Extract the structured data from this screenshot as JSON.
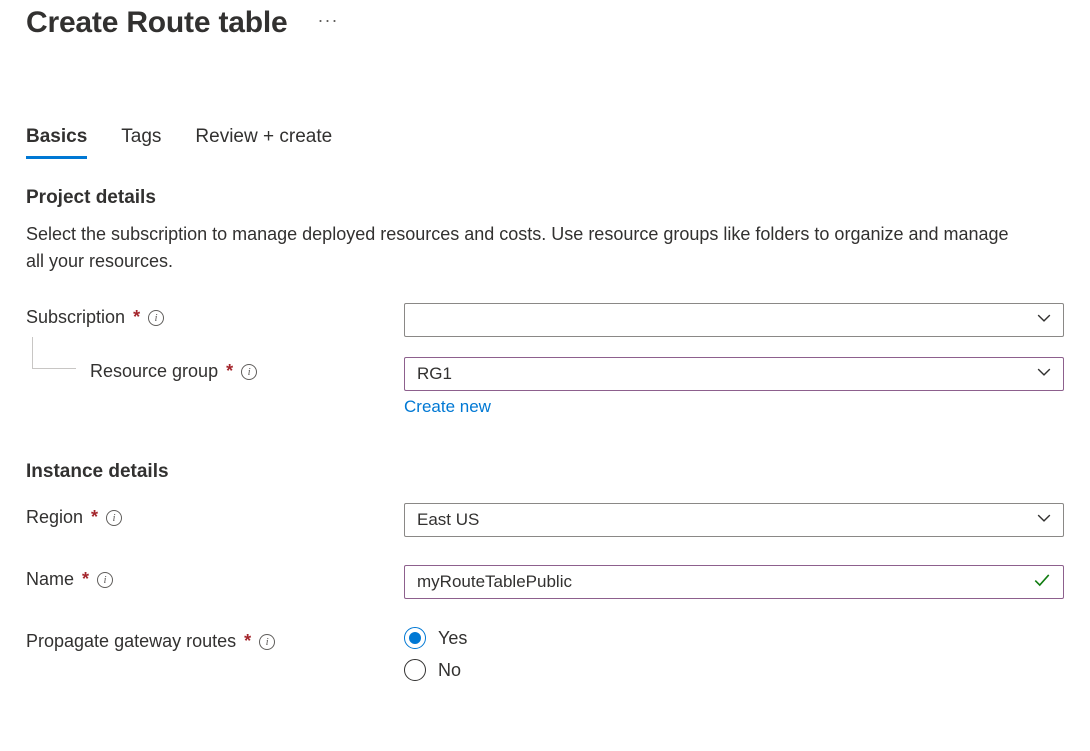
{
  "page": {
    "title": "Create Route table"
  },
  "tabs": [
    {
      "label": "Basics",
      "active": true
    },
    {
      "label": "Tags",
      "active": false
    },
    {
      "label": "Review + create",
      "active": false
    }
  ],
  "project_details": {
    "heading": "Project details",
    "description": "Select the subscription to manage deployed resources and costs. Use resource groups like folders to organize and manage all your resources.",
    "subscription": {
      "label": "Subscription",
      "value": ""
    },
    "resource_group": {
      "label": "Resource group",
      "value": "RG1",
      "create_new": "Create new"
    }
  },
  "instance_details": {
    "heading": "Instance details",
    "region": {
      "label": "Region",
      "value": "East US"
    },
    "name": {
      "label": "Name",
      "value": "myRouteTablePublic"
    },
    "propagate": {
      "label": "Propagate gateway routes",
      "options": {
        "yes": "Yes",
        "no": "No"
      },
      "selected": "yes"
    }
  }
}
